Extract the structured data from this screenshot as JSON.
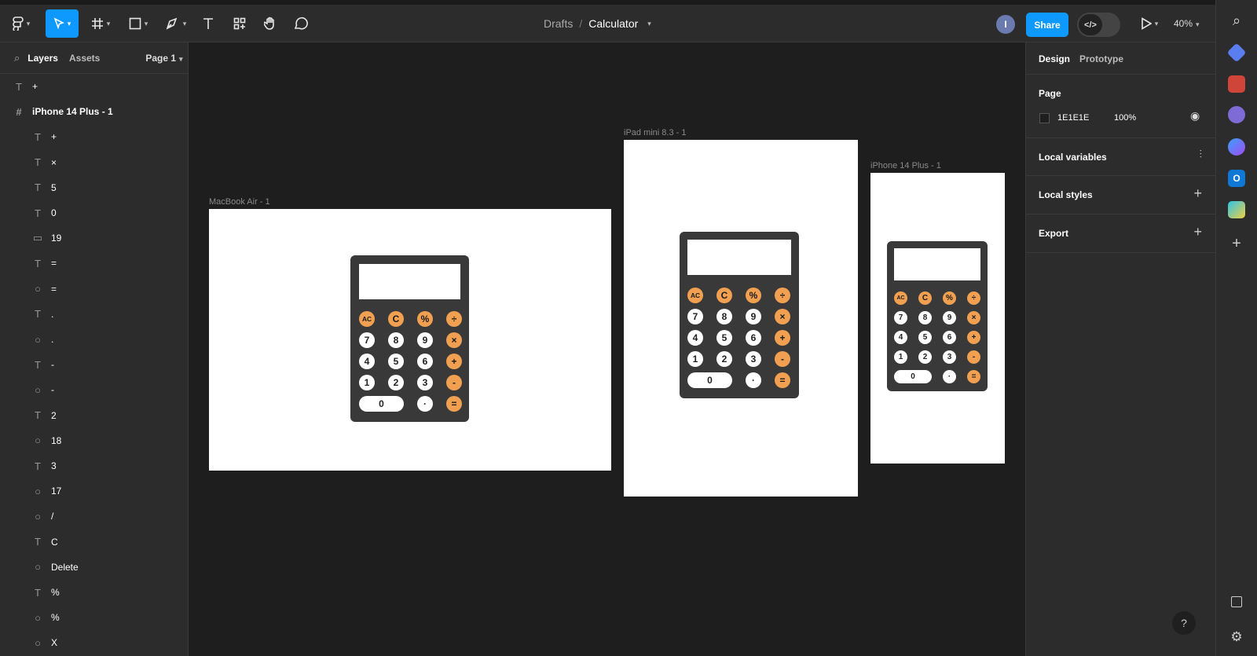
{
  "toolbar": {
    "breadcrumb_root": "Drafts",
    "breadcrumb_sep": "/",
    "file_name": "Calculator",
    "avatar_initial": "I",
    "share_label": "Share",
    "dev_label": "</>",
    "zoom": "40%"
  },
  "left_panel": {
    "tab_layers": "Layers",
    "tab_assets": "Assets",
    "page": "Page 1",
    "layers": [
      {
        "icon": "T",
        "label": "+",
        "level": 0
      },
      {
        "icon": "#",
        "label": "iPhone 14 Plus - 1",
        "level": 0
      },
      {
        "icon": "T",
        "label": "+",
        "level": 1
      },
      {
        "icon": "T",
        "label": "×",
        "level": 1
      },
      {
        "icon": "T",
        "label": "5",
        "level": 1
      },
      {
        "icon": "T",
        "label": "0",
        "level": 1
      },
      {
        "icon": "▭",
        "label": "19",
        "level": 1
      },
      {
        "icon": "T",
        "label": "=",
        "level": 1
      },
      {
        "icon": "○",
        "label": "=",
        "level": 1
      },
      {
        "icon": "T",
        "label": ".",
        "level": 1
      },
      {
        "icon": "○",
        "label": ".",
        "level": 1
      },
      {
        "icon": "T",
        "label": "-",
        "level": 1
      },
      {
        "icon": "○",
        "label": "-",
        "level": 1
      },
      {
        "icon": "T",
        "label": "2",
        "level": 1
      },
      {
        "icon": "○",
        "label": "18",
        "level": 1
      },
      {
        "icon": "T",
        "label": "3",
        "level": 1
      },
      {
        "icon": "○",
        "label": "17",
        "level": 1
      },
      {
        "icon": "○",
        "label": "/",
        "level": 1
      },
      {
        "icon": "T",
        "label": "C",
        "level": 1
      },
      {
        "icon": "○",
        "label": "Delete",
        "level": 1
      },
      {
        "icon": "T",
        "label": "%",
        "level": 1
      },
      {
        "icon": "○",
        "label": "%",
        "level": 1
      },
      {
        "icon": "○",
        "label": "X",
        "level": 1
      }
    ]
  },
  "right_panel": {
    "tab_design": "Design",
    "tab_prototype": "Prototype",
    "page_heading": "Page",
    "page_color_hex": "1E1E1E",
    "page_color": "#1e1e1e",
    "page_opacity": "100%",
    "local_variables": "Local variables",
    "local_styles": "Local styles",
    "export": "Export"
  },
  "canvas": {
    "frames": [
      {
        "label": "MacBook Air - 1"
      },
      {
        "label": "iPad mini 8.3 - 1"
      },
      {
        "label": "iPhone 14 Plus - 1"
      }
    ],
    "keys": [
      [
        "AC",
        "C",
        "%",
        "÷"
      ],
      [
        "7",
        "8",
        "9",
        "×"
      ],
      [
        "4",
        "5",
        "6",
        "+"
      ],
      [
        "1",
        "2",
        "3",
        "-"
      ],
      [
        "0",
        "·",
        "="
      ]
    ]
  },
  "help_label": "?",
  "colors": {
    "accent": "#0d99ff",
    "orange_key": "#f0a050",
    "calc_body": "#3a3939",
    "canvas": "#1e1e1e"
  }
}
